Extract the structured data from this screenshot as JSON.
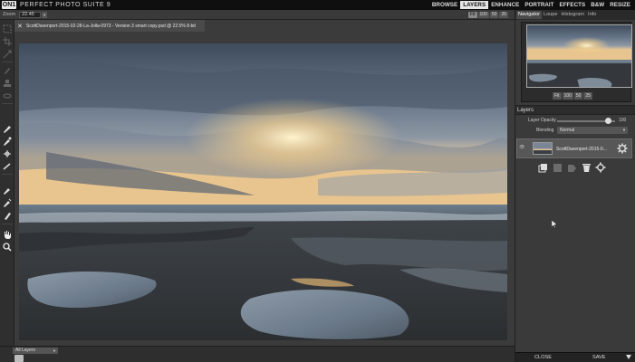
{
  "app": {
    "logo": "ON1",
    "title": "PERFECT PHOTO SUITE 9"
  },
  "modules": [
    "BROWSE",
    "LAYERS",
    "ENHANCE",
    "PORTRAIT",
    "EFFECTS",
    "B&W",
    "RESIZE"
  ],
  "active_module": "LAYERS",
  "options_bar": {
    "zoom_label": "Zoom",
    "zoom_value": "22.45",
    "zoom_buttons": [
      "Fit",
      "100",
      "50",
      "25"
    ],
    "active_zoom": "Fit"
  },
  "document": {
    "tab_title": "ScottDavenport-2015-02-28-La-Jolla-0973 - Version 3 smart copy.psd @ 22.5% 8-bit",
    "close_glyph": "✕"
  },
  "panel": {
    "tabs": [
      "Navigator",
      "Loupe",
      "Histogram",
      "Info"
    ],
    "active_tab": "Navigator",
    "nav_zoom_buttons": [
      "Fit",
      "100",
      "50",
      "25"
    ],
    "layers_title": "Layers",
    "opacity_label": "Layer Opacity",
    "opacity_value": "100",
    "blending_label": "Blending",
    "blending_value": "Normal",
    "layer_name": "ScottDavenport-2015-0...",
    "close_label": "CLOSE",
    "save_label": "SAVE"
  },
  "bottom_bar": {
    "layers_select": "All Layers"
  },
  "colors": {
    "active_module_bg": "#e6e6e6",
    "panel_bg": "#3a3a3a",
    "canvas_bg": "#3b3b3b"
  }
}
